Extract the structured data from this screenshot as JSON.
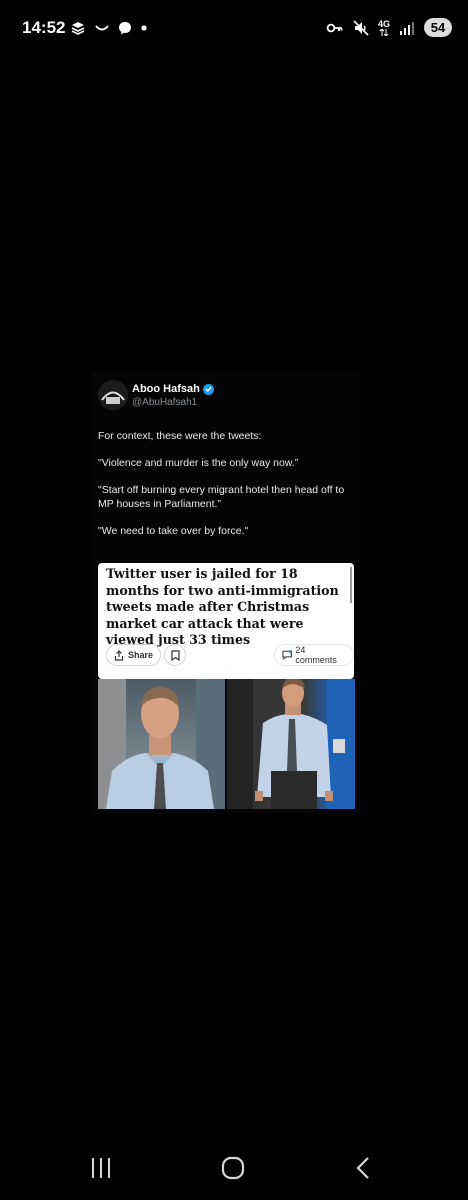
{
  "status_bar": {
    "time": "14:52",
    "network": "4G",
    "battery": "54"
  },
  "post": {
    "author_name": "Aboo Hafsah",
    "author_handle": "@AbuHafsah1",
    "verified": true,
    "paragraphs": [
      "For context, these were the tweets:",
      "\"Violence and murder is the only way now.”",
      "\"Start off burning every migrant hotel then head off to MP houses in Parliament.”",
      "\"We need to take over by force.\""
    ],
    "card": {
      "headline": "Twitter user is jailed for 18 months for two anti-immigration tweets made after Christmas market car attack that were viewed just 33 times",
      "share_label": "Share",
      "comments_label": "24 comments"
    }
  },
  "colors": {
    "background": "#000000",
    "verified_badge": "#1d9bf0",
    "card_background": "#ffffff"
  },
  "nav_bar": {
    "icons": [
      "recent-apps-icon",
      "home-icon",
      "back-icon"
    ]
  }
}
